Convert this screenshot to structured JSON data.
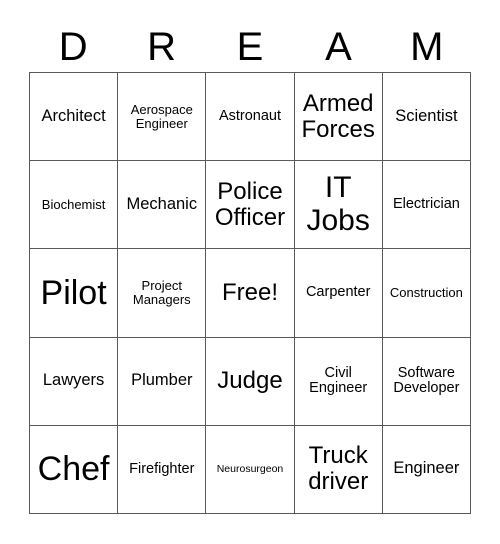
{
  "card": {
    "title": "DREAM",
    "header_letters": [
      "D",
      "R",
      "E",
      "A",
      "M"
    ],
    "free_space_label": "Free!",
    "grid_line_color": "#595959",
    "background_color": "#ffffff",
    "text_color": "#000000",
    "rows": 5,
    "columns": 5,
    "cells": [
      [
        {
          "text": "Architect",
          "size": "fs-lg"
        },
        {
          "text": "Aerospace Engineer",
          "size": "fs-sm"
        },
        {
          "text": "Astronaut",
          "size": "fs-md"
        },
        {
          "text": "Armed Forces",
          "size": "fs-2xl"
        },
        {
          "text": "Scientist",
          "size": "fs-lg"
        }
      ],
      [
        {
          "text": "Biochemist",
          "size": "fs-sm"
        },
        {
          "text": "Mechanic",
          "size": "fs-lg"
        },
        {
          "text": "Police Officer",
          "size": "fs-2xl"
        },
        {
          "text": "IT Jobs",
          "size": "fs-3xl"
        },
        {
          "text": "Electrician",
          "size": "fs-md"
        }
      ],
      [
        {
          "text": "Pilot",
          "size": "fs-4xl"
        },
        {
          "text": "Project Managers",
          "size": "fs-sm"
        },
        {
          "text": "Free!",
          "size": "fs-2xl"
        },
        {
          "text": "Carpenter",
          "size": "fs-md"
        },
        {
          "text": "Construction",
          "size": "fs-sm"
        }
      ],
      [
        {
          "text": "Lawyers",
          "size": "fs-lg"
        },
        {
          "text": "Plumber",
          "size": "fs-lg"
        },
        {
          "text": "Judge",
          "size": "fs-2xl"
        },
        {
          "text": "Civil Engineer",
          "size": "fs-md"
        },
        {
          "text": "Software Developer",
          "size": "fs-md"
        }
      ],
      [
        {
          "text": "Chef",
          "size": "fs-4xl"
        },
        {
          "text": "Firefighter",
          "size": "fs-md"
        },
        {
          "text": "Neurosurgeon",
          "size": "fs-xs"
        },
        {
          "text": "Truck driver",
          "size": "fs-2xl"
        },
        {
          "text": "Engineer",
          "size": "fs-lg"
        }
      ]
    ]
  }
}
